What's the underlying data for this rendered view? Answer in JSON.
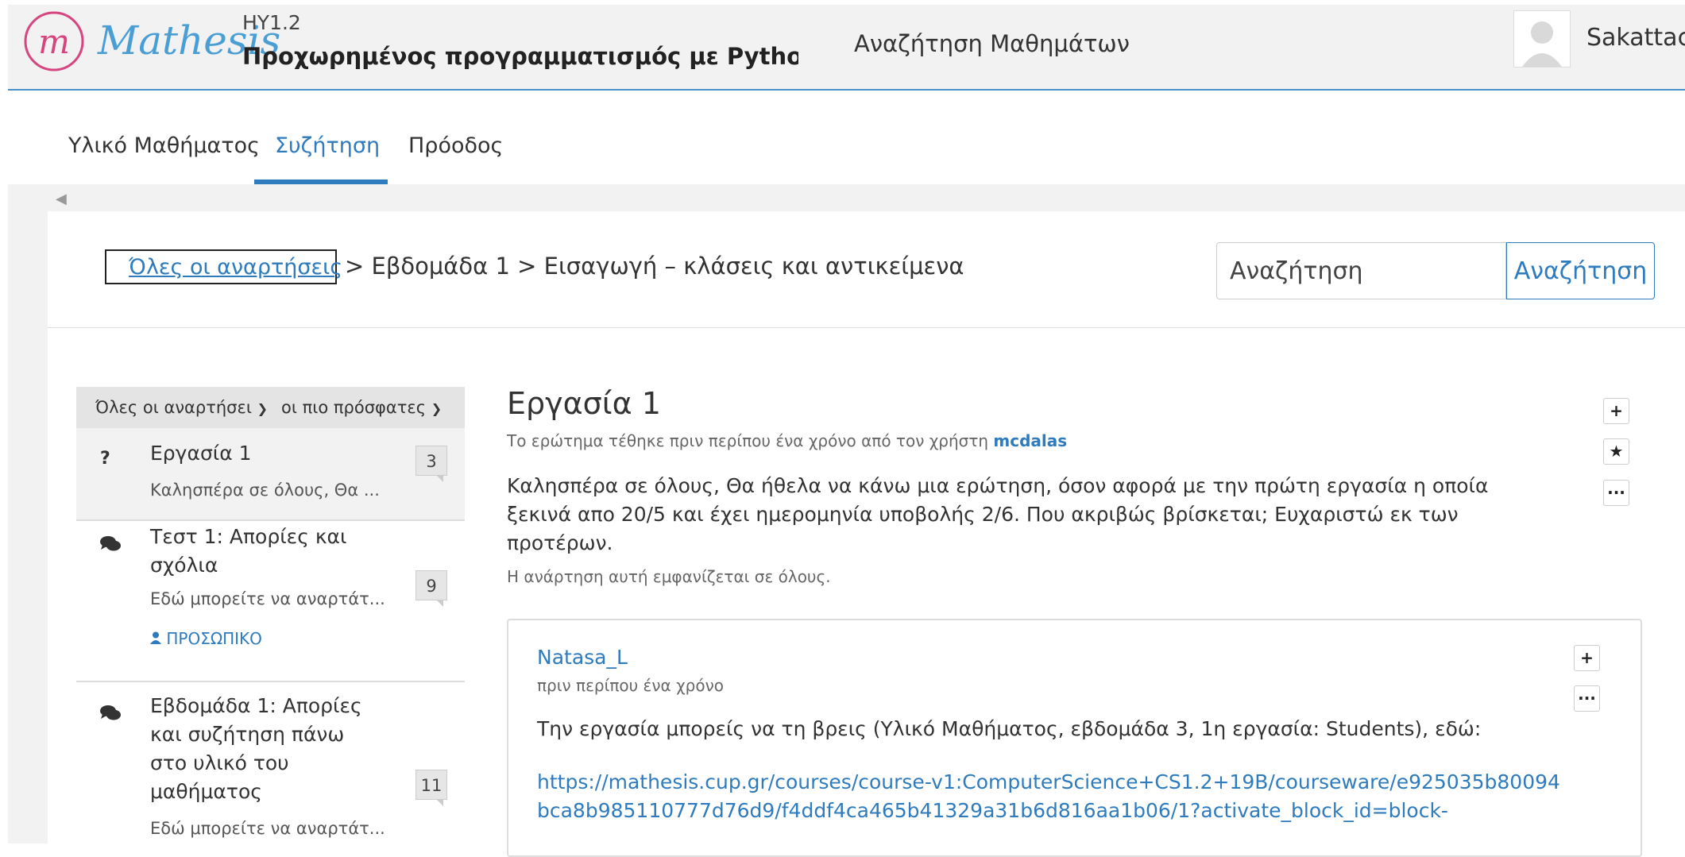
{
  "header": {
    "brand": "Mathesis",
    "course_code": "HY1.2",
    "course_title": "Προχωρημένος προγραμματισμός με Python (Αρχε",
    "course_search": "Αναζήτηση Μαθημάτων",
    "username": "Sakattack"
  },
  "tabs": [
    {
      "label": "Υλικό Μαθήματος"
    },
    {
      "label": "Συζήτηση"
    },
    {
      "label": "Πρόοδος"
    }
  ],
  "breadcrumb": {
    "all_posts": "Όλες οι αναρτήσεις",
    "trail": "> Εβδομάδα 1 > Εισαγωγή – κλάσεις και αντικείμενα"
  },
  "search": {
    "placeholder": "Αναζήτηση",
    "button": "Αναζήτηση"
  },
  "sidebar": {
    "filter": "Όλες οι αναρτήσει",
    "sort": "οι πιο πρόσφατες",
    "posts": [
      {
        "title": "Εργασία 1",
        "preview": "Καλησπέρα σε όλους, Θα ...",
        "count": "3"
      },
      {
        "title": "Τεστ 1: Απορίες και σχόλια",
        "preview": "Εδώ μπορείτε να αναρτάτ...",
        "count": "9",
        "tag": "ΠΡΟΣΩΠΙΚΟ"
      },
      {
        "title": "Εβδομάδα 1: Απορίες και συζήτηση πάνω στο υλικό του μαθήματος",
        "preview": "Εδώ μπορείτε να αναρτάτ...",
        "count": "11"
      }
    ]
  },
  "thread": {
    "title": "Εργασία 1",
    "meta_prefix": "Το ερώτημα τέθηκε πριν περίπου ένα χρόνο από τον χρήστη",
    "author": "mcdalas",
    "body": "Καλησπέρα σε όλους, Θα ήθελα να κάνω μια ερώτηση, όσον αφορά με την πρώτη εργασία η οποία ξεκινά απο 20/5 και έχει ημερομηνία υποβολής 2/6. Που ακριβώς βρίσκεται; Ευχαριστώ εκ των προτέρων.",
    "visibility": "Η ανάρτηση αυτή εμφανίζεται σε όλους."
  },
  "response": {
    "author": "Natasa_L",
    "time": "πριν περίπου ένα χρόνο",
    "text": "Την εργασία μπορείς να τη βρεις (Υλικό Μαθήματος, εβδομάδα 3, 1η εργασία: Students), εδώ:",
    "link": "https://mathesis.cup.gr/courses/course-v1:ComputerScience+CS1.2+19B/courseware/e925035b80094bca8b985110777d76d9/f4ddf4ca465b41329a31b6d816aa1b06/1?activate_block_id=block-"
  },
  "colors": {
    "accent": "#2e7bbd",
    "logo": "#d6457f"
  }
}
